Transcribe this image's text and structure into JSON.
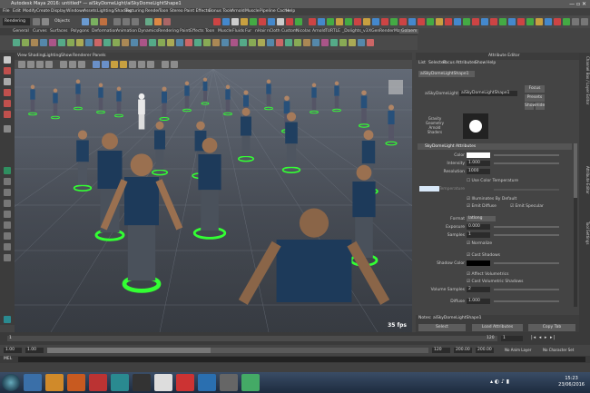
{
  "window": {
    "title": "Autodesk Maya 2016: untitled* — aiSkyDomeLight/aiSkyDomeLightShape1"
  },
  "menubar": {
    "items": [
      "File",
      "Edit",
      "Modify",
      "Create",
      "Display",
      "Windows",
      "Assets",
      "Lighting/Shading",
      "Texturing",
      "Render",
      "Toon",
      "Stereo",
      "Paint Effects",
      "Bonus Tools",
      "Arnold",
      "Muscle",
      "Pipeline Cache",
      "Help"
    ]
  },
  "statusline": {
    "mode": "Rendering",
    "objects_label": "Objects"
  },
  "shelf": {
    "tabs": [
      "General",
      "Curves",
      "Surfaces",
      "Polygons",
      "Deformation",
      "Animation",
      "Dynamics",
      "Rendering",
      "PaintEffects",
      "Toon",
      "Muscle",
      "Fluids",
      "Fur",
      "nHair",
      "nCloth",
      "Custom",
      "Nicolas",
      "Arnold",
      "TURTLE",
      "_Dolights_v3",
      "XGen",
      "RenderMan",
      "Golaem"
    ]
  },
  "viewport": {
    "menu": [
      "View",
      "Shading",
      "Lighting",
      "Show",
      "Renderer",
      "Panels"
    ],
    "fps": "35 fps"
  },
  "attribute_editor": {
    "header": "Attribute Editor",
    "menu": [
      "List",
      "Selected",
      "Focus",
      "Attributes",
      "Show",
      "Help"
    ],
    "node_tab": "aiSkyDomeLightShape1",
    "node_label": "aiSkyDomeLight:",
    "node_value": "aiSkyDomeLightShape1",
    "buttons": {
      "focus": "Focus",
      "presets": "Presets",
      "show": "Show",
      "hide": "Hide"
    },
    "swatch_caption": "Gravity Geometry Arnold Shaders",
    "section_title": "SkyDomeLight Attributes",
    "fields": [
      {
        "label": "Color",
        "value": ""
      },
      {
        "label": "Intensity",
        "value": "1.000"
      },
      {
        "label": "Resolution",
        "value": "1000"
      }
    ],
    "use_color_temp": "Use Color Temperature",
    "temperature_label": "Temperature",
    "illuminates_default": "Illuminates By Default",
    "emit_diffuse": "Emit Diffuse",
    "emit_specular": "Emit Specular",
    "format_label": "Format",
    "format_value": "latlong",
    "exposure": {
      "label": "Exposure",
      "value": "0.000"
    },
    "samples": {
      "label": "Samples",
      "value": "1"
    },
    "normalize": "Normalize",
    "cast_shadows": "Cast Shadows",
    "shadow_color_label": "Shadow Color",
    "affect_volumetrics": "Affect Volumetrics",
    "cast_volumetric_shadows": "Cast Volumetric Shadows",
    "volume_samples": {
      "label": "Volume Samples",
      "value": "2"
    },
    "diffuse": {
      "label": "Diffuse",
      "value": "1.000"
    },
    "notes_label": "Notes: aiSkyDomeLightShape1",
    "bottom_buttons": [
      "Select",
      "Load Attributes",
      "Copy Tab"
    ],
    "side_tabs": [
      "Channel Box / Layer Editor",
      "Attribute Editor",
      "Tool Settings"
    ]
  },
  "timeslider": {
    "start": "1",
    "end": "120"
  },
  "rangeslider": {
    "start": "1.00",
    "start2": "1.00",
    "current": "1",
    "end": "120",
    "range_end": "200.00",
    "range_end2": "200.00",
    "anim_layer": "No Anim Layer",
    "char_set": "No Character Set"
  },
  "cmdline": {
    "lang": "MEL"
  },
  "clock": {
    "time": "15:23",
    "date": "23/06/2016"
  }
}
